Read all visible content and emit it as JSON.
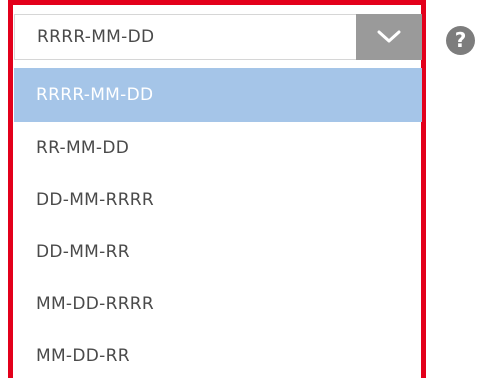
{
  "dropdown": {
    "selected_value": "RRRR-MM-DD",
    "toggle_icon": "chevron-down-icon",
    "options": [
      {
        "label": "RRRR-MM-DD",
        "highlighted": true
      },
      {
        "label": "RR-MM-DD",
        "highlighted": false
      },
      {
        "label": "DD-MM-RRRR",
        "highlighted": false
      },
      {
        "label": "DD-MM-RR",
        "highlighted": false
      },
      {
        "label": "MM-DD-RRRR",
        "highlighted": false
      },
      {
        "label": "MM-DD-RR",
        "highlighted": false
      }
    ]
  },
  "help": {
    "glyph": "?",
    "icon": "help-icon"
  },
  "colors": {
    "highlight_frame": "#e3001b",
    "selected_option_bg": "#a5c5e8",
    "toggle_bg": "#9a9a9a",
    "help_bg": "#7d7d7d"
  }
}
